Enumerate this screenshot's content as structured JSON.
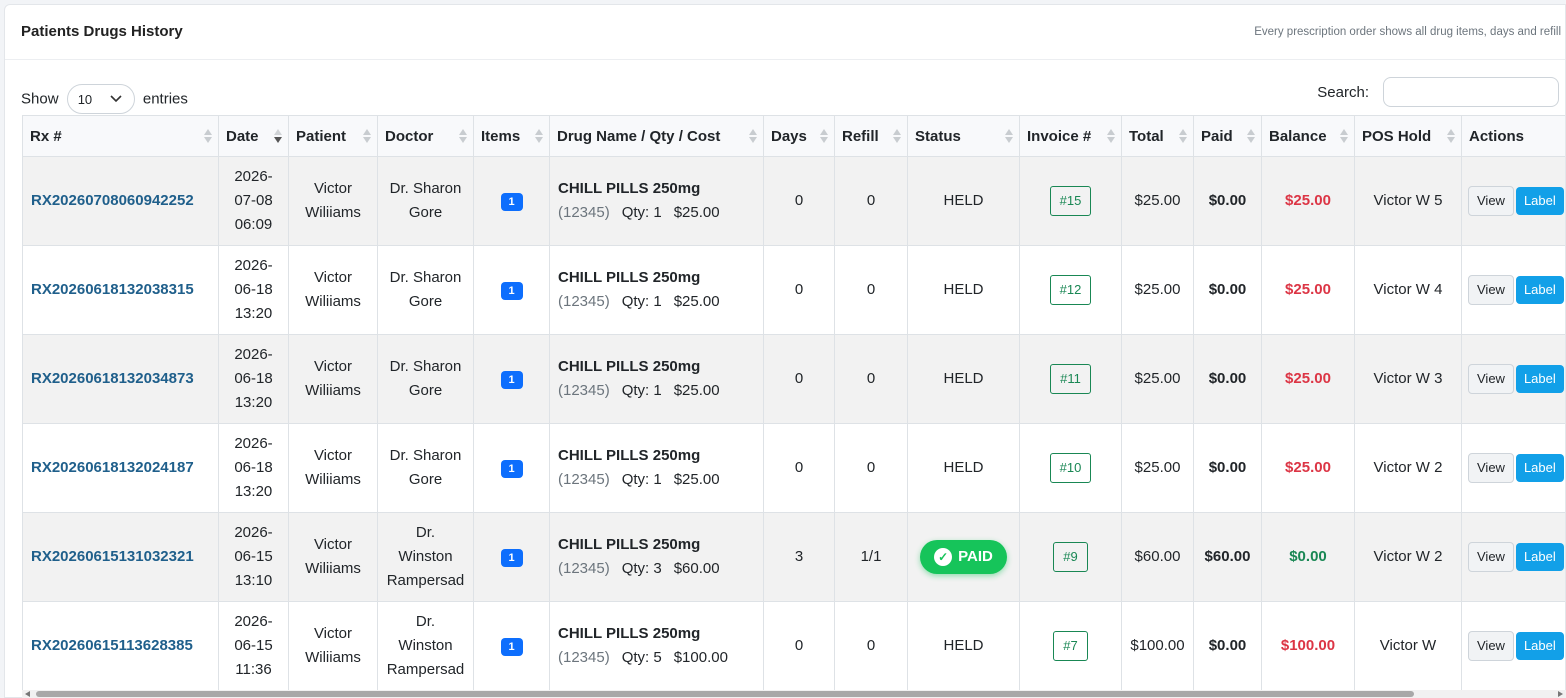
{
  "header": {
    "title": "Patients Drugs History",
    "subtitle": "Every prescription order shows all drug items, days and refill"
  },
  "controls": {
    "show_label": "Show",
    "page_length": "10",
    "entries_label": "entries",
    "search_label": "Search:",
    "search_value": ""
  },
  "columns": [
    "Rx #",
    "Date",
    "Patient",
    "Doctor",
    "Items",
    "Drug Name / Qty / Cost",
    "Days",
    "Refill",
    "Status",
    "Invoice #",
    "Total",
    "Paid",
    "Balance",
    "POS Hold",
    "Actions"
  ],
  "sort_column": "Date",
  "rows": [
    {
      "rx": "RX20260708060942252",
      "date": [
        "2026-",
        "07-08",
        "06:09"
      ],
      "patient": [
        "Victor",
        "Wiliiams"
      ],
      "doctor": [
        "Dr. Sharon",
        "Gore"
      ],
      "items": "1",
      "drug_name": "CHILL PILLS 250mg",
      "drug_code": "(12345)",
      "drug_qty": "Qty: 1",
      "drug_cost": "$25.00",
      "days": "0",
      "refill": "0",
      "status": "HELD",
      "invoice": "#15",
      "total": "$25.00",
      "paid": "$0.00",
      "balance": "$25.00",
      "pos_hold": "Victor W 5",
      "view": "View",
      "label": "Label"
    },
    {
      "rx": "RX20260618132038315",
      "date": [
        "2026-",
        "06-18",
        "13:20"
      ],
      "patient": [
        "Victor",
        "Wiliiams"
      ],
      "doctor": [
        "Dr. Sharon",
        "Gore"
      ],
      "items": "1",
      "drug_name": "CHILL PILLS 250mg",
      "drug_code": "(12345)",
      "drug_qty": "Qty: 1",
      "drug_cost": "$25.00",
      "days": "0",
      "refill": "0",
      "status": "HELD",
      "invoice": "#12",
      "total": "$25.00",
      "paid": "$0.00",
      "balance": "$25.00",
      "pos_hold": "Victor W 4",
      "view": "View",
      "label": "Label"
    },
    {
      "rx": "RX20260618132034873",
      "date": [
        "2026-",
        "06-18",
        "13:20"
      ],
      "patient": [
        "Victor",
        "Wiliiams"
      ],
      "doctor": [
        "Dr. Sharon",
        "Gore"
      ],
      "items": "1",
      "drug_name": "CHILL PILLS 250mg",
      "drug_code": "(12345)",
      "drug_qty": "Qty: 1",
      "drug_cost": "$25.00",
      "days": "0",
      "refill": "0",
      "status": "HELD",
      "invoice": "#11",
      "total": "$25.00",
      "paid": "$0.00",
      "balance": "$25.00",
      "pos_hold": "Victor W 3",
      "view": "View",
      "label": "Label"
    },
    {
      "rx": "RX20260618132024187",
      "date": [
        "2026-",
        "06-18",
        "13:20"
      ],
      "patient": [
        "Victor",
        "Wiliiams"
      ],
      "doctor": [
        "Dr. Sharon",
        "Gore"
      ],
      "items": "1",
      "drug_name": "CHILL PILLS 250mg",
      "drug_code": "(12345)",
      "drug_qty": "Qty: 1",
      "drug_cost": "$25.00",
      "days": "0",
      "refill": "0",
      "status": "HELD",
      "invoice": "#10",
      "total": "$25.00",
      "paid": "$0.00",
      "balance": "$25.00",
      "pos_hold": "Victor W 2",
      "view": "View",
      "label": "Label"
    },
    {
      "rx": "RX20260615131032321",
      "date": [
        "2026-",
        "06-15",
        "13:10"
      ],
      "patient": [
        "Victor",
        "Wiliiams"
      ],
      "doctor": [
        "Dr.",
        "Winston",
        "Rampersad"
      ],
      "items": "1",
      "drug_name": "CHILL PILLS 250mg",
      "drug_code": "(12345)",
      "drug_qty": "Qty: 3",
      "drug_cost": "$60.00",
      "days": "3",
      "refill": "1/1",
      "status": "PAID",
      "invoice": "#9",
      "total": "$60.00",
      "paid": "$60.00",
      "balance": "$0.00",
      "pos_hold": "Victor W 2",
      "view": "View",
      "label": "Label"
    },
    {
      "rx": "RX20260615113628385",
      "date": [
        "2026-",
        "06-15",
        "11:36"
      ],
      "patient": [
        "Victor",
        "Wiliiams"
      ],
      "doctor": [
        "Dr.",
        "Winston",
        "Rampersad"
      ],
      "items": "1",
      "drug_name": "CHILL PILLS 250mg",
      "drug_code": "(12345)",
      "drug_qty": "Qty: 5",
      "drug_cost": "$100.00",
      "days": "0",
      "refill": "0",
      "status": "HELD",
      "invoice": "#7",
      "total": "$100.00",
      "paid": "$0.00",
      "balance": "$100.00",
      "pos_hold": "Victor W",
      "view": "View",
      "label": "Label"
    }
  ],
  "colors": {
    "rx_link": "#1f5f8b",
    "balance_due": "#dc3545",
    "balance_zero": "#198754",
    "paid_badge": "#16c45a",
    "items_badge": "#0d6efd",
    "label_button": "#12a0e8"
  }
}
